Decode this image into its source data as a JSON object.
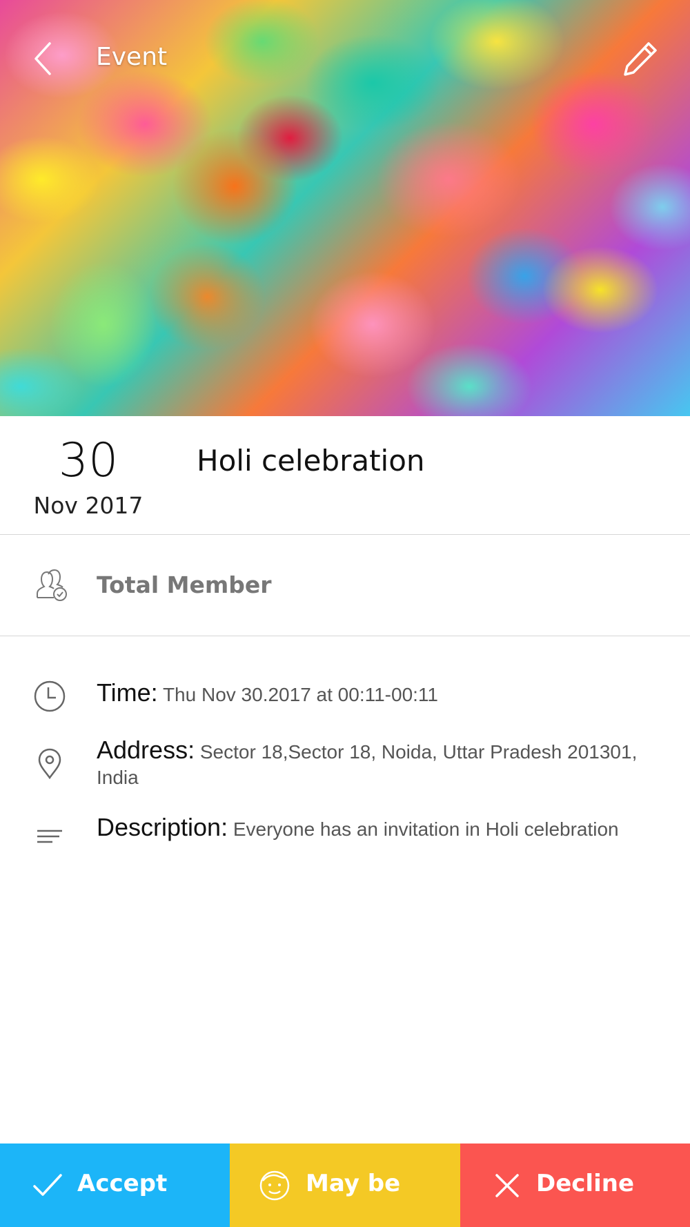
{
  "header": {
    "title": "Event",
    "back_icon": "chevron-left-icon",
    "edit_icon": "pencil-icon"
  },
  "event": {
    "day": "30",
    "month_year": "Nov 2017",
    "title": "Holi celebration"
  },
  "members": {
    "label": "Total Member",
    "icon": "group-check-icon"
  },
  "details": {
    "time_key": "Time:",
    "time_value": "Thu Nov 30.2017 at 00:11-00:11",
    "address_key": "Address:",
    "address_value": "Sector 18,Sector 18, Noida, Uttar Pradesh 201301, India",
    "description_key": "Description:",
    "description_value": "Everyone has an invitation in Holi celebration"
  },
  "actions": {
    "accept_label": "Accept",
    "maybe_label": "May be",
    "decline_label": "Decline"
  },
  "colors": {
    "accept": "#1cb5f8",
    "maybe": "#f4c925",
    "decline": "#fb5550"
  }
}
